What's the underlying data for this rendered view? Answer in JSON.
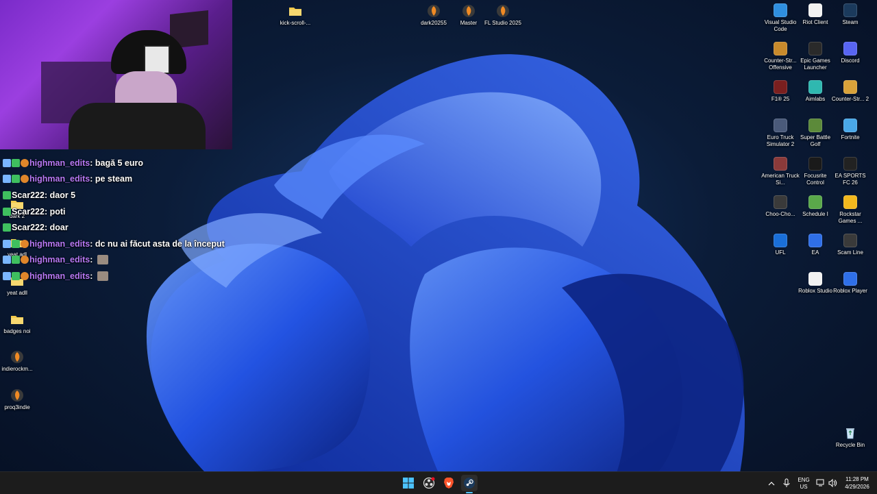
{
  "desktop": {
    "top_icons": [
      {
        "label": "kick-scroll-...",
        "icon": "folder-icon"
      },
      {
        "label": "dark20255",
        "icon": "fl-studio-icon"
      },
      {
        "label": "Master",
        "icon": "fl-studio-icon"
      },
      {
        "label": "FL Studio 2025",
        "icon": "fl-studio-icon"
      }
    ],
    "left_icons": [
      {
        "label": "dark 2",
        "icon": "folder-icon"
      },
      {
        "label": "yeat adl",
        "icon": "folder-icon"
      },
      {
        "label": "yeat adll",
        "icon": "folder-icon"
      },
      {
        "label": "badges noi",
        "icon": "folder-icon"
      },
      {
        "label": "indierockm...",
        "icon": "fl-studio-icon"
      },
      {
        "label": "proq3indie",
        "icon": "fl-studio-icon"
      }
    ],
    "right_icons": [
      {
        "label": "Visual Studio Code",
        "icon": "vscode-icon",
        "color": "#2f8fe0"
      },
      {
        "label": "Riot Client",
        "icon": "file-icon",
        "color": "#f2f2f2"
      },
      {
        "label": "Steam",
        "icon": "steam-icon",
        "color": "#1b3a5c"
      },
      {
        "label": "Counter-Str... Offensive",
        "icon": "csgo-icon",
        "color": "#c88a2c"
      },
      {
        "label": "Epic Games Launcher",
        "icon": "epic-games-icon",
        "color": "#2a2a2a"
      },
      {
        "label": "Discord",
        "icon": "discord-icon",
        "color": "#5865f2"
      },
      {
        "label": "F1® 25",
        "icon": "f1-icon",
        "color": "#7a1f1f"
      },
      {
        "label": "Aimlabs",
        "icon": "aimlabs-icon",
        "color": "#2fb8b0"
      },
      {
        "label": "Counter-Str... 2",
        "icon": "cs2-icon",
        "color": "#d9a23a"
      },
      {
        "label": "Euro Truck Simulator 2",
        "icon": "ets2-icon",
        "color": "#4a5a7a"
      },
      {
        "label": "Super Battle Golf",
        "icon": "golf-icon",
        "color": "#5c8a3a"
      },
      {
        "label": "Fortnite",
        "icon": "fortnite-icon",
        "color": "#4aa8e8"
      },
      {
        "label": "American Truck Si...",
        "icon": "ats-icon",
        "color": "#8a3a3a"
      },
      {
        "label": "Focusrite Control",
        "icon": "focusrite-icon",
        "color": "#1a1a1a"
      },
      {
        "label": "EA SPORTS FC 26",
        "icon": "fc26-icon",
        "color": "#222222"
      },
      {
        "label": "Choo-Cho...",
        "icon": "choo-choo-icon",
        "color": "#3a3a3a"
      },
      {
        "label": "Schedule I",
        "icon": "schedule-icon",
        "color": "#5aa84a"
      },
      {
        "label": "Rockstar Games ...",
        "icon": "rockstar-icon",
        "color": "#f2b81e"
      },
      {
        "label": "UFL",
        "icon": "ufl-icon",
        "color": "#1a6fd8"
      },
      {
        "label": "EA",
        "icon": "ea-icon",
        "color": "#2f6fe8"
      },
      {
        "label": "Scam Line",
        "icon": "scam-line-icon",
        "color": "#3a3a3a"
      },
      {
        "label": "Roblox Studio",
        "icon": "roblox-studio-icon",
        "color": "#f2f2f2"
      },
      {
        "label": "Roblox Player",
        "icon": "roblox-icon",
        "color": "#2f6fe8"
      }
    ],
    "recycle_bin": {
      "label": "Recycle Bin",
      "icon": "recycle-bin-icon"
    }
  },
  "chat": {
    "messages": [
      {
        "user": "highman_edits",
        "text": "bagă 5 euro",
        "color": "#b779f5",
        "emote": false
      },
      {
        "user": "highman_edits",
        "text": "pe steam",
        "color": "#b779f5",
        "emote": false
      },
      {
        "user": "Scar222",
        "text": "daor 5",
        "color": "#ffffff",
        "emote": false
      },
      {
        "user": "Scar222",
        "text": "poti",
        "color": "#ffffff",
        "emote": false
      },
      {
        "user": "Scar222",
        "text": "doar",
        "color": "#ffffff",
        "emote": false
      },
      {
        "user": "highman_edits",
        "text": "dc nu ai făcut asta de la început",
        "color": "#b779f5",
        "emote": false
      },
      {
        "user": "highman_edits",
        "text": "",
        "color": "#b779f5",
        "emote": true
      },
      {
        "user": "highman_edits",
        "text": "",
        "color": "#b779f5",
        "emote": true
      }
    ]
  },
  "taskbar": {
    "apps": [
      "windows-start-icon",
      "obs-icon",
      "brave-icon",
      "steam-icon"
    ],
    "lang_top": "ENG",
    "lang_bottom": "US",
    "time": "11:28 PM",
    "date": "4/29/2026"
  }
}
